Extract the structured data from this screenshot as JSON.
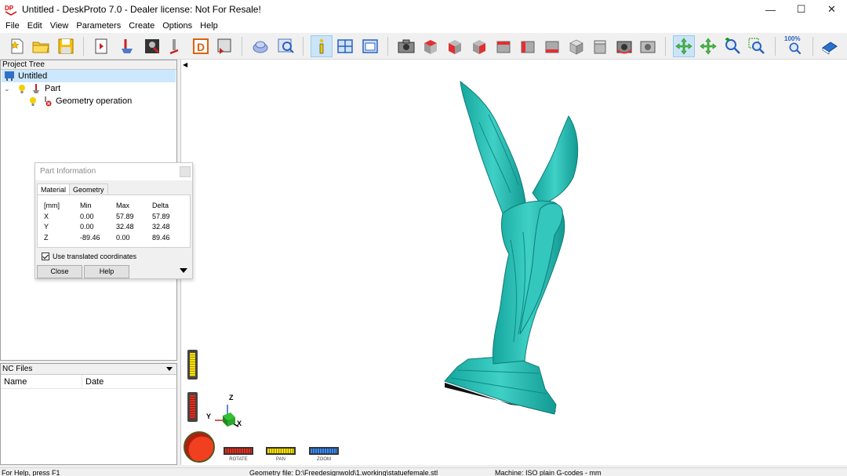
{
  "window": {
    "title": "Untitled - DeskProto 7.0 - Dealer license: Not For Resale!"
  },
  "menu": [
    "File",
    "Edit",
    "View",
    "Parameters",
    "Create",
    "Options",
    "Help"
  ],
  "toolbar": {
    "zoom_percent": "100%"
  },
  "project_tree": {
    "header": "Project Tree",
    "items": [
      {
        "label": "Untitled"
      },
      {
        "label": "Part"
      },
      {
        "label": "Geometry operation"
      }
    ]
  },
  "nc_files": {
    "header": "NC Files",
    "columns": [
      "Name",
      "Date"
    ]
  },
  "part_info": {
    "title": "Part Information",
    "tabs": [
      "Material",
      "Geometry"
    ],
    "table": {
      "headers": [
        "[mm]",
        "Min",
        "Max",
        "Delta"
      ],
      "rows": [
        [
          "X",
          "0.00",
          "57.89",
          "57.89"
        ],
        [
          "Y",
          "0.00",
          "32.48",
          "32.48"
        ],
        [
          "Z",
          "-89.46",
          "0.00",
          "89.46"
        ]
      ]
    },
    "checkbox_label": "Use translated coordinates",
    "checkbox_checked": true,
    "close_label": "Close",
    "help_label": "Help"
  },
  "view_controls": {
    "rotate": "ROTATE",
    "pan": "PAN",
    "zoom": "ZOOM"
  },
  "axes": {
    "x": "X",
    "y": "Y",
    "z": "Z"
  },
  "status": {
    "help": "For Help, press F1",
    "geometry_file": "Geometry file: D:\\Freedesignwold\\1.working\\statuefemale.stl",
    "machine": "Machine: ISO plain G-codes - mm"
  },
  "colors": {
    "model": "#2bbcb4",
    "accent_blue": "#0078d7",
    "selection": "#cce8ff"
  }
}
